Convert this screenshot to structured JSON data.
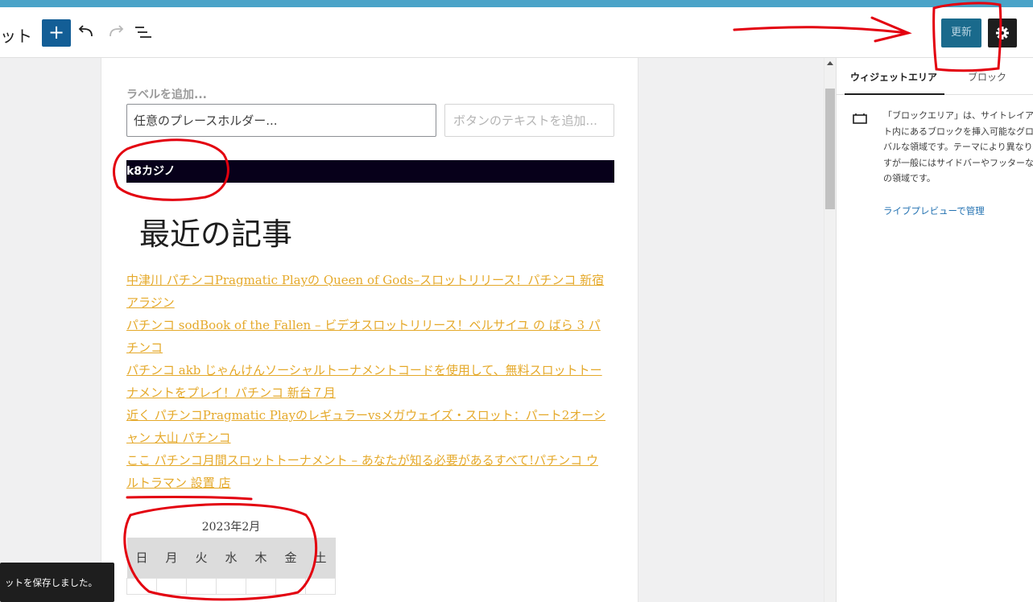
{
  "header": {
    "title": "ット",
    "add_label": "+",
    "update_label": "更新"
  },
  "form": {
    "label": "ラベルを追加...",
    "search_value": "任意のプレースホルダー...",
    "button_placeholder": "ボタンのテキストを追加..."
  },
  "widget_title": "k8カジノ",
  "recent_heading": "最近の記事",
  "posts": [
    "中津川 パチンコPragmatic Playの Queen of Gods–スロットリリース！パチンコ 新宿 アラジン",
    "パチンコ sodBook of the Fallen – ビデオスロットリリース！ベルサイユ の ばら 3 パチンコ",
    "パチンコ akb じゃんけんソーシャルトーナメントコードを使用して、無料スロットトーナメントをプレイ！パチンコ 新台７月",
    "近く パチンコPragmatic Playのレギュラーvsメガウェイズ・スロット：パート2オーシャン 大山 パチンコ",
    "ここ パチンコ月間スロットトーナメント – あなたが知る必要があるすべて!パチンコ ウルトラマン 設置 店"
  ],
  "calendar": {
    "caption": "2023年2月",
    "weekdays": [
      "日",
      "月",
      "火",
      "水",
      "木",
      "金",
      "土"
    ]
  },
  "sidebar": {
    "tab_active": "ウィジェットエリア",
    "tab_inactive": "ブロック",
    "description": "「ブロックエリア」は、サイトレイアウト内にあるブロックを挿入可能なグローバルな領域です。テーマにより異なりますが一般にはサイドバーやフッターなどの領域です。",
    "manage_link": "ライブプレビューで管理"
  },
  "snackbar": "ットを保存しました。",
  "colors": {
    "accent": "#135e96",
    "link": "#e5a92a",
    "title_bar": "#07001a",
    "annotation": "#e3000f"
  }
}
